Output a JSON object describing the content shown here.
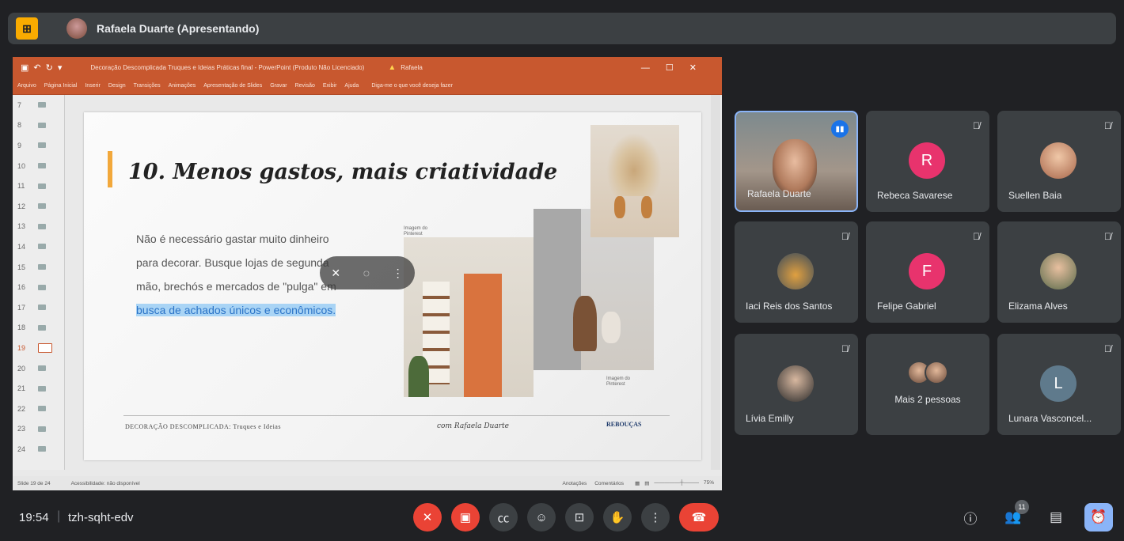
{
  "topbar": {
    "presenter": "Rafaela Duarte (Apresentando)"
  },
  "ppt": {
    "title": "Decoração Descomplicada Truques e Ideias Práticas final - PowerPoint (Produto Não Licenciado)",
    "user": "Rafaela",
    "menu": [
      "Arquivo",
      "Página Inicial",
      "Inserir",
      "Design",
      "Transições",
      "Animações",
      "Apresentação de Slides",
      "Gravar",
      "Revisão",
      "Exibir",
      "Ajuda"
    ],
    "tell_me": "Diga-me o que você deseja fazer",
    "thumb_numbers": [
      "7",
      "8",
      "9",
      "10",
      "11",
      "12",
      "13",
      "14",
      "15",
      "16",
      "17",
      "18",
      "19",
      "20",
      "21",
      "22",
      "23",
      "24"
    ],
    "selected_slide": "19",
    "status_slide": "Slide 19 de 24",
    "status_access": "Acessibilidade: não disponível",
    "status_notes": "Anotações",
    "status_comments": "Comentários",
    "zoom": "75%"
  },
  "slide": {
    "title": "10. Menos gastos, mais criatividade",
    "body_1": "Não é necessário gastar muito dinheiro para decorar. Busque lojas de segunda mão, brechós e mercados de \"pulga\" em",
    "body_highlight": "busca de achados únicos e econômicos.",
    "caption_1": "Imagem do Pinterest",
    "caption_2": "Imagem do Pinterest",
    "footer_left": "DECORAÇÃO DESCOMPLICADA: Truques e Ideias",
    "footer_mid": "com Rafaela Duarte",
    "footer_right": "REBOUÇAS"
  },
  "participants": [
    {
      "name": "Rafaela Duarte",
      "speaking": true
    },
    {
      "name": "Rebeca Savarese",
      "initial": "R",
      "color": "#e8336d"
    },
    {
      "name": "Suellen Baia"
    },
    {
      "name": "Iaci Reis dos Santos"
    },
    {
      "name": "Felipe Gabriel",
      "initial": "F",
      "color": "#e8336d"
    },
    {
      "name": "Elizama Alves"
    },
    {
      "name": "Lívia Emilly"
    },
    {
      "name": "Mais 2 pessoas"
    },
    {
      "name": "Lunara Vasconcel...",
      "initial": "L",
      "color": "#5f7a8c"
    }
  ],
  "bottom": {
    "time": "19:54",
    "meeting_code": "tzh-sqht-edv",
    "participant_count": "11"
  }
}
